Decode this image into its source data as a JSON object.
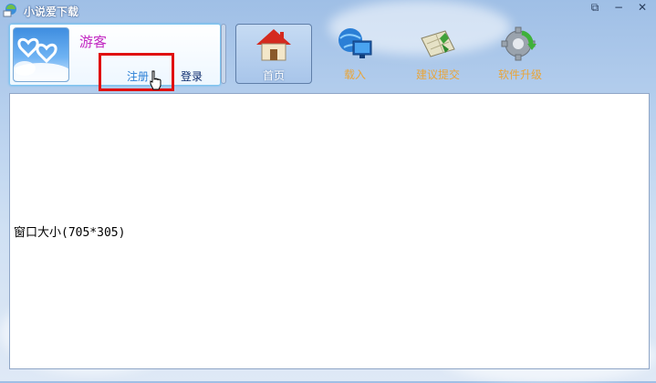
{
  "window": {
    "title": "小说爱下载",
    "buttons": {
      "restore": "⧉",
      "minimize": "−",
      "close": "✕"
    }
  },
  "user": {
    "name": "游客",
    "register_label": "注册",
    "login_label": "登录",
    "avatar_icon": "hearts-cloud-avatar"
  },
  "toolbar": {
    "items": [
      {
        "label": "首页",
        "icon": "home-icon",
        "active": true
      },
      {
        "label": "载入",
        "icon": "globe-monitor-icon",
        "active": false
      },
      {
        "label": "建议提交",
        "icon": "map-suggest-icon",
        "active": false
      },
      {
        "label": "软件升级",
        "icon": "gear-upgrade-icon",
        "active": false
      }
    ]
  },
  "content": {
    "text": "窗口大小(705*305)"
  },
  "colors": {
    "accent": "#7fc6f0",
    "username": "#c227c2",
    "highlight_box": "#e01010",
    "nav_label": "#e8a53a"
  }
}
